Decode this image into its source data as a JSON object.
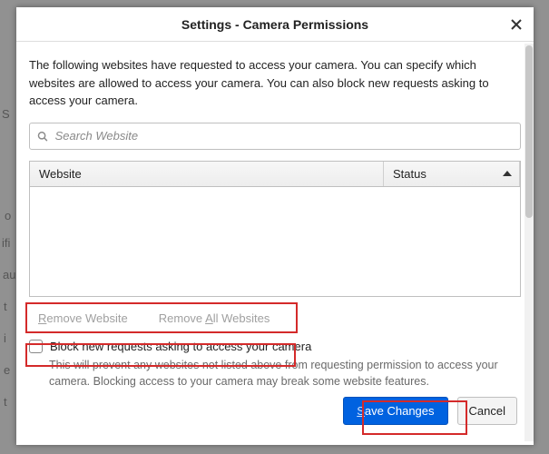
{
  "title": "Settings - Camera Permissions",
  "description": "The following websites have requested to access your camera. You can specify which websites are allowed to access your camera. You can also block new requests asking to access your camera.",
  "search": {
    "placeholder": "Search Website",
    "value": ""
  },
  "table": {
    "headers": {
      "website": "Website",
      "status": "Status"
    },
    "sort": {
      "column": "status",
      "dir": "asc"
    },
    "rows": []
  },
  "buttons": {
    "remove_website_pre": "R",
    "remove_website_rest": "emove Website",
    "remove_all_pre": "R",
    "remove_all_mid": "emove ",
    "remove_all_u": "A",
    "remove_all_rest": "ll Websites",
    "save_u": "S",
    "save_rest": "ave Changes",
    "cancel": "Cancel"
  },
  "block": {
    "label": "Block new requests asking to access your camera",
    "checked": false,
    "hint": "This will prevent any websites not listed above from requesting permission to access your camera. Blocking access to your camera may break some website features."
  },
  "ghost": {
    "g1": "S",
    "g2": "o",
    "g3": "ifi",
    "g4": "au",
    "g5": "t",
    "g6": "i",
    "g7": "e",
    "g8": "t"
  }
}
